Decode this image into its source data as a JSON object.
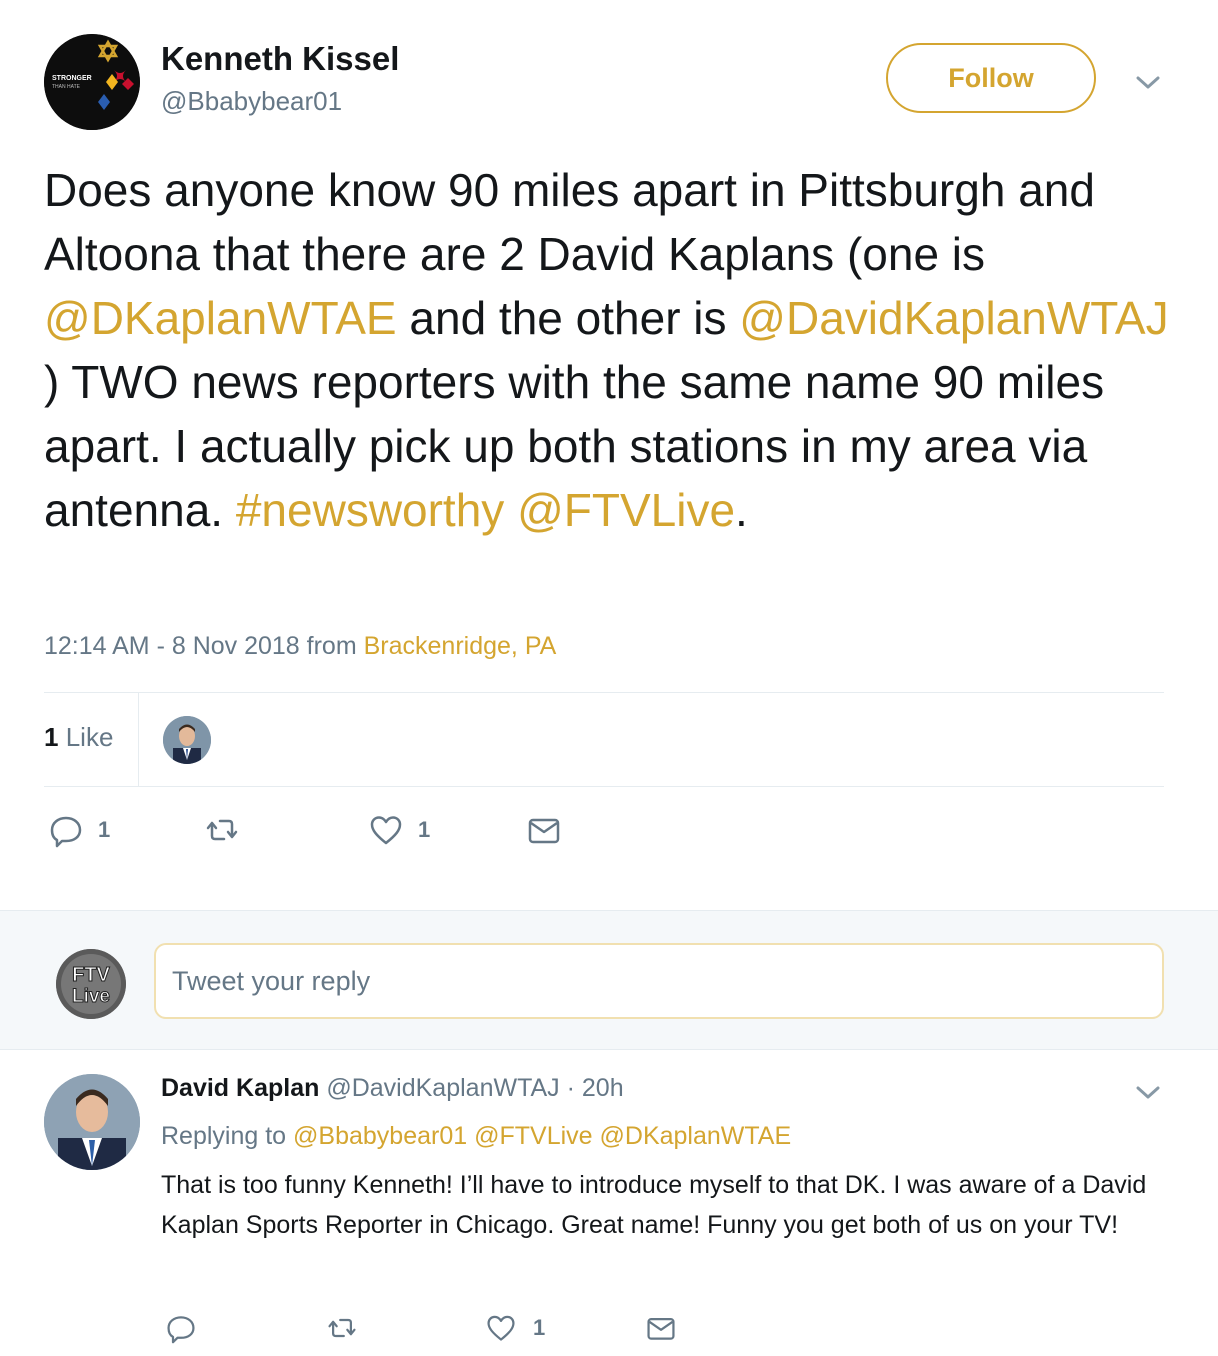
{
  "tweet": {
    "author_name": "Kenneth Kissel",
    "author_handle": "@Bbabybear01",
    "follow_label": "Follow",
    "avatar_text_top": "STRONGER",
    "avatar_text_bottom": "THAN HATE",
    "text_segments": [
      {
        "text": "Does anyone know 90 miles apart in Pittsburgh and Altoona that there are 2 David Kaplans (one is ",
        "link": false
      },
      {
        "text": "@DKaplanWTAE",
        "link": true
      },
      {
        "text": " and the other is ",
        "link": false
      },
      {
        "text": "@DavidKaplanWTAJ",
        "link": true
      },
      {
        "text": " ) TWO news reporters with the same name 90 miles apart. I actually pick up both stations in my area via antenna. ",
        "link": false
      },
      {
        "text": "#newsworthy",
        "link": true
      },
      {
        "text": " ",
        "link": false
      },
      {
        "text": "@FTVLive",
        "link": true
      },
      {
        "text": ".",
        "link": false
      }
    ],
    "timestamp": "12:14 AM - 8 Nov 2018 from",
    "location": "Brackenridge, PA",
    "like_count_num": "1",
    "like_count_label": "Like",
    "actions": {
      "reply_count": "1",
      "retweet_count": "",
      "like_count": "1"
    }
  },
  "reply_box": {
    "placeholder": "Tweet your reply",
    "avatar_text_top": "FTV",
    "avatar_text_bottom": "Live"
  },
  "reply": {
    "author_name": "David Kaplan",
    "author_handle": "@DavidKaplanWTAJ",
    "time": "· 20h",
    "replying_to_label": "Replying to",
    "replying_to": [
      "@Bbabybear01",
      "@FTVLive",
      "@DKaplanWTAE"
    ],
    "text": "That is too funny Kenneth!  I’ll have to introduce myself to that DK.  I was aware of a David Kaplan Sports Reporter in Chicago.  Great name!  Funny you get both of us on your TV!",
    "actions": {
      "reply_count": "",
      "retweet_count": "",
      "like_count": "1"
    }
  },
  "colors": {
    "accent": "#d4a530",
    "text": "#14171a",
    "secondary": "#657786",
    "divider": "#e6ecf0",
    "reply_bg": "#f5f8fa"
  }
}
